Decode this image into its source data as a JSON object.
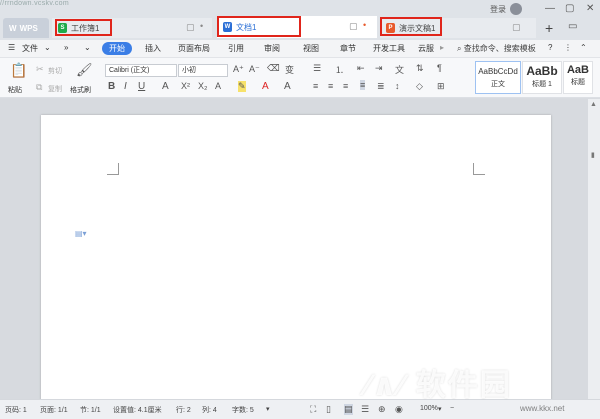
{
  "watermark": {
    "url_top": "//rrndown.vcskv.com",
    "logo_text": "软件园",
    "site": "www.kkx.net"
  },
  "tabs": {
    "wps": "WPS",
    "sheet": "工作簿1",
    "doc": "文档1",
    "ppt": "演示文稿1"
  },
  "account": {
    "login": "登录"
  },
  "menu": {
    "file": "文件",
    "start": "开始",
    "insert": "插入",
    "page_layout": "页面布局",
    "references": "引用",
    "review": "审阅",
    "view": "视图",
    "chapter": "章节",
    "developer": "开发工具",
    "cloud": "云服",
    "search": "查找命令、搜索模板"
  },
  "ribbon": {
    "cut": "剪切",
    "copy": "复制",
    "paste": "粘贴",
    "format_painter": "格式刷",
    "font_name": "Calibri (正文)",
    "font_size": "小初",
    "styles": [
      {
        "sample": "AaBbCcDd",
        "name": "正文"
      },
      {
        "sample": "AaBb",
        "name": "标题 1"
      },
      {
        "sample": "AaB",
        "name": "标题"
      }
    ]
  },
  "status": {
    "page_no": "页码: 1",
    "pages": "页面: 1/1",
    "section": "节: 1/1",
    "set_value": "设置值: 4.1厘米",
    "row": "行: 2",
    "col": "列: 4",
    "word_count": "字数: 5",
    "zoom": "100%"
  },
  "colors": {
    "accent": "#3b7ee6",
    "highlight_box": "#e0251b",
    "sheet_icon": "#1faa4a",
    "ppt_icon": "#e8592b"
  }
}
